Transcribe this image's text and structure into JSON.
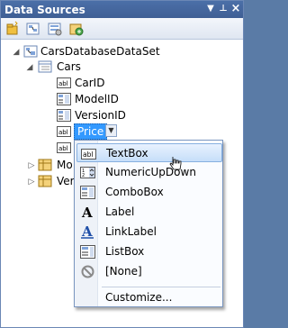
{
  "window": {
    "title": "Data Sources",
    "pin_glyph": "‑ ⊥",
    "close_glyph": "×"
  },
  "toolbar": {
    "buttons": [
      {
        "icon": "add-data-source-icon"
      },
      {
        "icon": "edit-dataset-icon"
      },
      {
        "icon": "configure-dataset-icon"
      },
      {
        "icon": "refresh-icon"
      }
    ]
  },
  "tree": {
    "root": {
      "label": "CarsDatabaseDataSet",
      "expand": "◢"
    },
    "table": {
      "label": "Cars",
      "expand": "◢"
    },
    "fields": [
      {
        "label": "CarID",
        "icon": "textbox-field-icon"
      },
      {
        "label": "ModelID",
        "icon": "combobox-field-icon"
      },
      {
        "label": "VersionID",
        "icon": "combobox-field-icon"
      },
      {
        "label": "Price",
        "icon": "textbox-field-icon",
        "selected": true
      },
      {
        "label": "",
        "icon": "textbox-field-icon"
      }
    ],
    "other_tables": [
      {
        "label": "Mo",
        "expand": "▷"
      },
      {
        "label": "Ver",
        "expand": "▷"
      }
    ]
  },
  "menu": {
    "items": [
      {
        "label": "TextBox",
        "icon": "textbox-icon",
        "highlighted": true
      },
      {
        "label": "NumericUpDown",
        "icon": "numeric-updown-icon"
      },
      {
        "label": "ComboBox",
        "icon": "combobox-icon"
      },
      {
        "label": "Label",
        "icon": "label-icon"
      },
      {
        "label": "LinkLabel",
        "icon": "linklabel-icon"
      },
      {
        "label": "ListBox",
        "icon": "listbox-icon"
      },
      {
        "label": "[None]",
        "icon": "none-icon"
      }
    ],
    "customize": "Customize..."
  },
  "colors": {
    "titlebar": "#4b6fa8",
    "selection": "#3399ff",
    "menu_highlight": "#c6def9"
  }
}
